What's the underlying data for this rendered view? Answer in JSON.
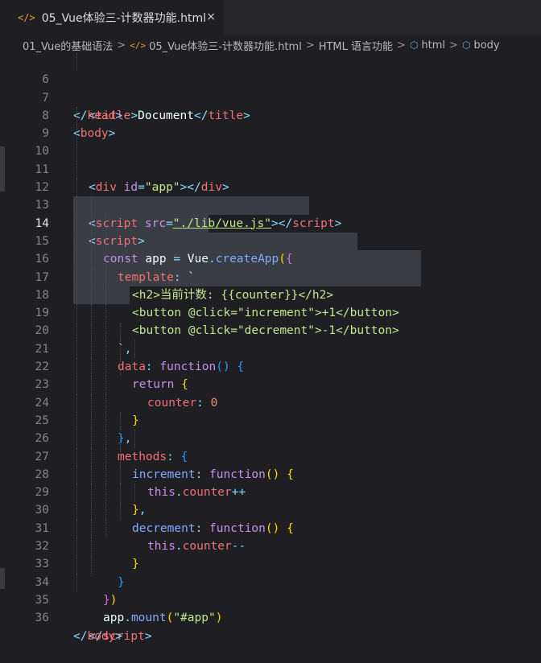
{
  "tab": {
    "icon": "</>",
    "title": "05_Vue体验三-计数器功能.html",
    "close": "×"
  },
  "breadcrumb": {
    "items": [
      "01_Vue的基础语法",
      "05_Vue体验三-计数器功能.html",
      "HTML 语言功能",
      "html",
      "body"
    ],
    "separator": ">"
  },
  "editor": {
    "active_line": 14,
    "lines": [
      {
        "n": "6"
      },
      {
        "n": "7"
      },
      {
        "n": "8"
      },
      {
        "n": "9"
      },
      {
        "n": "10"
      },
      {
        "n": "11"
      },
      {
        "n": "12"
      },
      {
        "n": "13"
      },
      {
        "n": "14"
      },
      {
        "n": "15"
      },
      {
        "n": "16"
      },
      {
        "n": "17"
      },
      {
        "n": "18"
      },
      {
        "n": "19"
      },
      {
        "n": "20"
      },
      {
        "n": "21"
      },
      {
        "n": "22"
      },
      {
        "n": "23"
      },
      {
        "n": "24"
      },
      {
        "n": "25"
      },
      {
        "n": "26"
      },
      {
        "n": "27"
      },
      {
        "n": "28"
      },
      {
        "n": "29"
      },
      {
        "n": "30"
      },
      {
        "n": "31"
      },
      {
        "n": "32"
      },
      {
        "n": "33"
      },
      {
        "n": "34"
      },
      {
        "n": "35"
      },
      {
        "n": "36"
      }
    ],
    "code": {
      "l6": [
        "<",
        "title",
        ">",
        "Document",
        "</",
        "title",
        ">"
      ],
      "l7": [
        "</",
        "head",
        ">"
      ],
      "l8": [
        "<",
        "body",
        ">"
      ],
      "l10": [
        "<",
        "div",
        " id",
        "=",
        "\"app\"",
        "></",
        "div",
        ">"
      ],
      "l12": [
        "<",
        "script",
        " src",
        "=",
        "\"./lib/vue.js\"",
        "></",
        "script",
        ">"
      ],
      "l13": [
        "<",
        "script",
        ">"
      ],
      "l14": [
        "const",
        " app ",
        "=",
        " Vue",
        ".",
        "createApp",
        "(",
        "{"
      ],
      "l15": [
        "template",
        ":",
        " `"
      ],
      "l16": [
        "<h2>当前计数: {{counter}}</h2>"
      ],
      "l17": [
        "<button @click=\"increment\">+1</button>"
      ],
      "l18": [
        "<button @click=\"decrement\">-1</button>"
      ],
      "l19": [
        "`",
        ","
      ],
      "l20": [
        "data",
        ":",
        " function",
        "(",
        ")",
        " {"
      ],
      "l21": [
        "return",
        " {"
      ],
      "l22": [
        "counter",
        ":",
        " 0"
      ],
      "l23": [
        "}"
      ],
      "l24": [
        "}",
        ","
      ],
      "l25": [
        "methods",
        ":",
        " {"
      ],
      "l26": [
        "increment",
        ":",
        " function",
        "(",
        ")",
        " {"
      ],
      "l27": [
        "this",
        ".",
        "counter",
        "++"
      ],
      "l28": [
        "}",
        ","
      ],
      "l29": [
        "decrement",
        ":",
        " function",
        "(",
        ")",
        " {"
      ],
      "l30": [
        "this",
        ".",
        "counter",
        "--"
      ],
      "l31": [
        "}"
      ],
      "l32": [
        "}"
      ],
      "l33": [
        "}",
        ")"
      ],
      "l34": [
        "app",
        ".",
        "mount",
        "(",
        "\"#app\"",
        ")"
      ],
      "l35": [
        "</",
        "script",
        ">"
      ],
      "l36": [
        "</",
        "body",
        ">"
      ]
    }
  },
  "colors": {
    "background": "#1f1f23",
    "tag": "#f07178",
    "string": "#c3e88d",
    "keyword": "#c792ea",
    "function": "#82aaff"
  }
}
